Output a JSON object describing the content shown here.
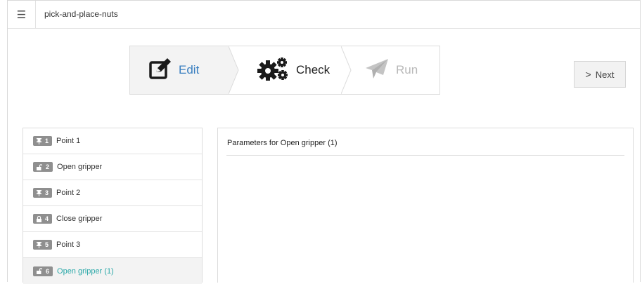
{
  "header": {
    "menu_icon": "hamburger-icon",
    "project_name": "pick-and-place-nuts"
  },
  "steps": [
    {
      "label": "Edit",
      "icon": "edit-icon",
      "state": "active",
      "color": "#3a7fc0"
    },
    {
      "label": "Check",
      "icon": "gears-icon",
      "state": "normal",
      "color": "#222222"
    },
    {
      "label": "Run",
      "icon": "paper-plane-icon",
      "state": "disabled",
      "color": "#b8b8b8"
    }
  ],
  "next_button": {
    "label": "Next",
    "icon": "chevron-right-icon"
  },
  "program": {
    "items": [
      {
        "number": "1",
        "label": "Point 1",
        "icon": "pin-icon"
      },
      {
        "number": "2",
        "label": "Open gripper",
        "icon": "unlock-icon"
      },
      {
        "number": "3",
        "label": "Point 2",
        "icon": "pin-icon"
      },
      {
        "number": "4",
        "label": "Close gripper",
        "icon": "lock-icon"
      },
      {
        "number": "5",
        "label": "Point 3",
        "icon": "pin-icon"
      },
      {
        "number": "6",
        "label": "Open gripper (1)",
        "icon": "unlock-icon",
        "selected": true
      }
    ],
    "selected_color": "#2aa8a8"
  },
  "parameters": {
    "title": "Parameters for  Open gripper (1)"
  }
}
